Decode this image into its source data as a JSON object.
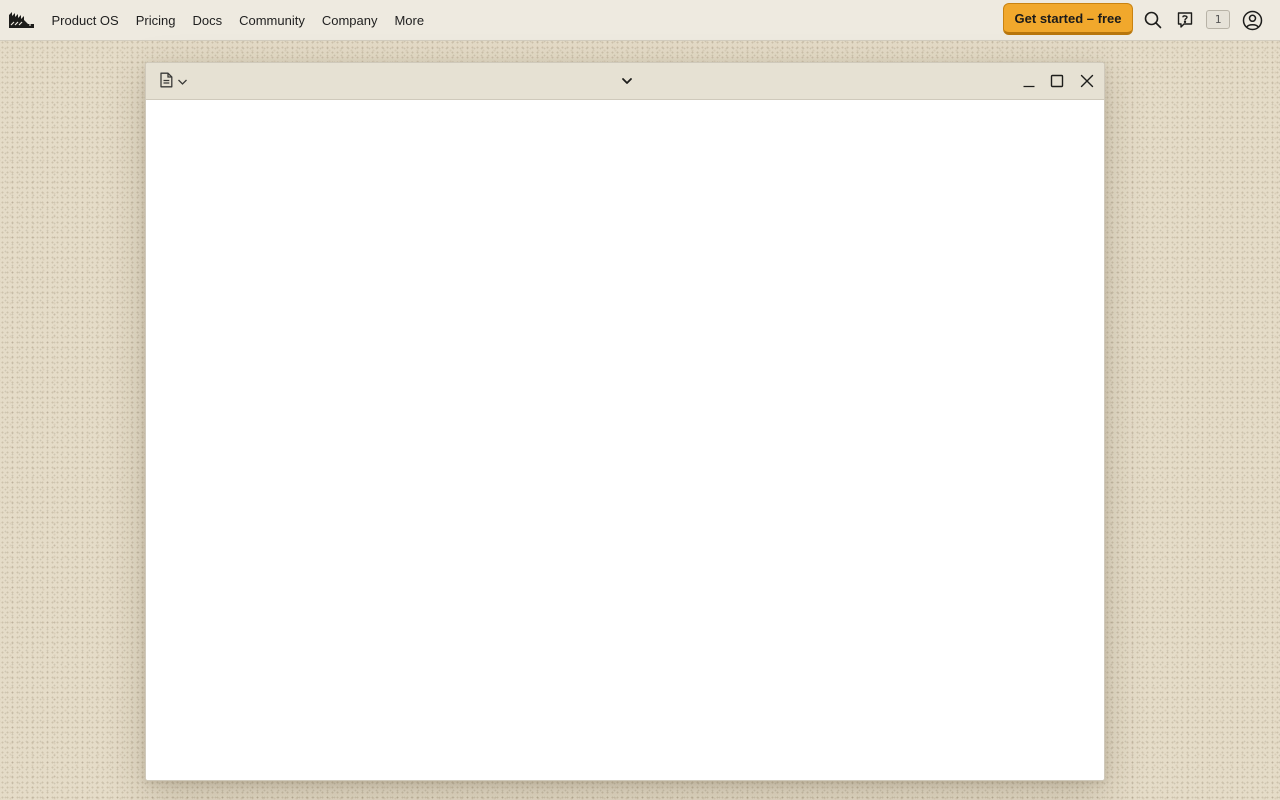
{
  "nav": {
    "logo_icon": "hedgehog-logo-icon",
    "items": [
      {
        "label": "Product OS"
      },
      {
        "label": "Pricing"
      },
      {
        "label": "Docs"
      },
      {
        "label": "Community"
      },
      {
        "label": "Company"
      },
      {
        "label": "More"
      }
    ],
    "cta_label": "Get started – free",
    "cta_color": "#f1a82c",
    "search_icon": "search-icon",
    "help_icon": "question-chat-icon",
    "badge_count": "1",
    "account_icon": "user-circle-icon"
  },
  "window": {
    "doc_icon": "document-icon",
    "menu_icon": "chevron-down-icon",
    "minimize_icon": "minimize-icon",
    "maximize_icon": "maximize-icon",
    "close_icon": "close-icon"
  },
  "colors": {
    "background": "#e5dcc8",
    "topbar": "#eeeae0",
    "titlebar": "#e6e1d3"
  }
}
